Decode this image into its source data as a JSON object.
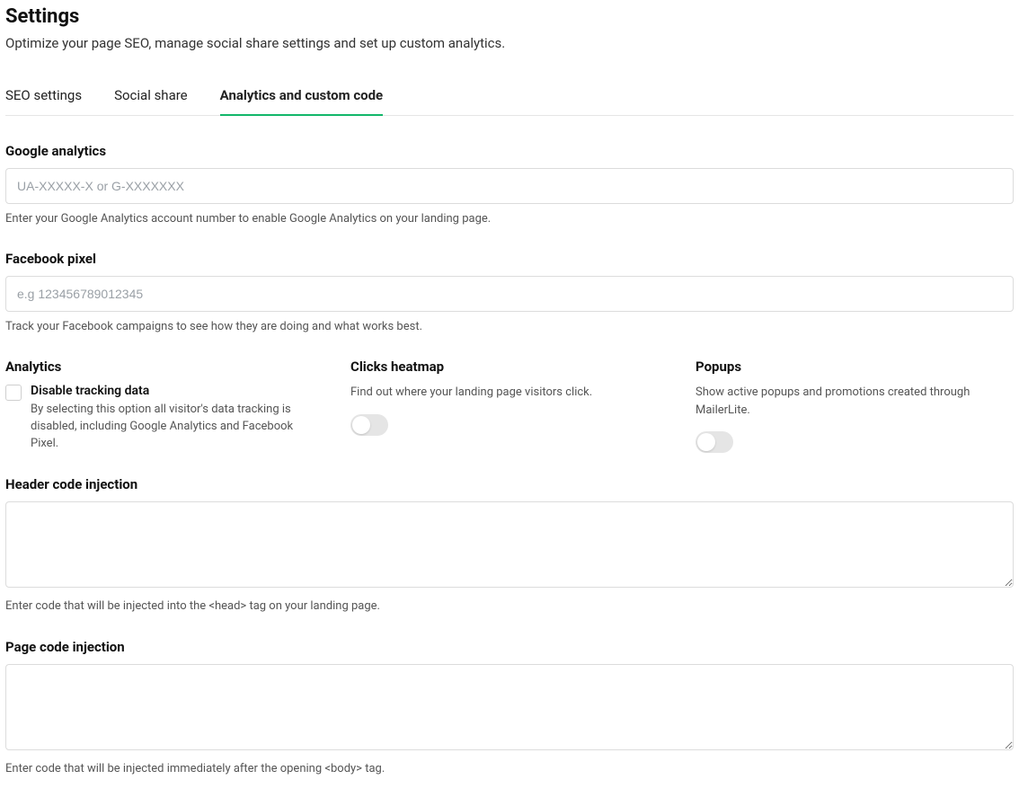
{
  "header": {
    "title": "Settings",
    "subtitle": "Optimize your page SEO, manage social share settings and set up custom analytics."
  },
  "tabs": [
    {
      "label": "SEO settings"
    },
    {
      "label": "Social share"
    },
    {
      "label": "Analytics and custom code"
    }
  ],
  "google_analytics": {
    "label": "Google analytics",
    "placeholder": "UA-XXXXX-X or G-XXXXXXX",
    "value": "",
    "help": "Enter your Google Analytics account number to enable Google Analytics on your landing page."
  },
  "facebook_pixel": {
    "label": "Facebook pixel",
    "placeholder": "e.g 123456789012345",
    "value": "",
    "help": "Track your Facebook campaigns to see how they are doing and what works best."
  },
  "analytics_col": {
    "label": "Analytics",
    "checkbox_label": "Disable tracking data",
    "checkbox_desc": "By selecting this option all visitor's data tracking is disabled, including Google Analytics and Facebook Pixel."
  },
  "heatmap_col": {
    "label": "Clicks heatmap",
    "desc": "Find out where your landing page visitors click."
  },
  "popups_col": {
    "label": "Popups",
    "desc": "Show active popups and promotions created through MailerLite."
  },
  "header_code": {
    "label": "Header code injection",
    "value": "",
    "help": "Enter code that will be injected into the <head> tag on your landing page."
  },
  "page_code": {
    "label": "Page code injection",
    "value": "",
    "help": "Enter code that will be injected immediately after the opening <body> tag."
  }
}
